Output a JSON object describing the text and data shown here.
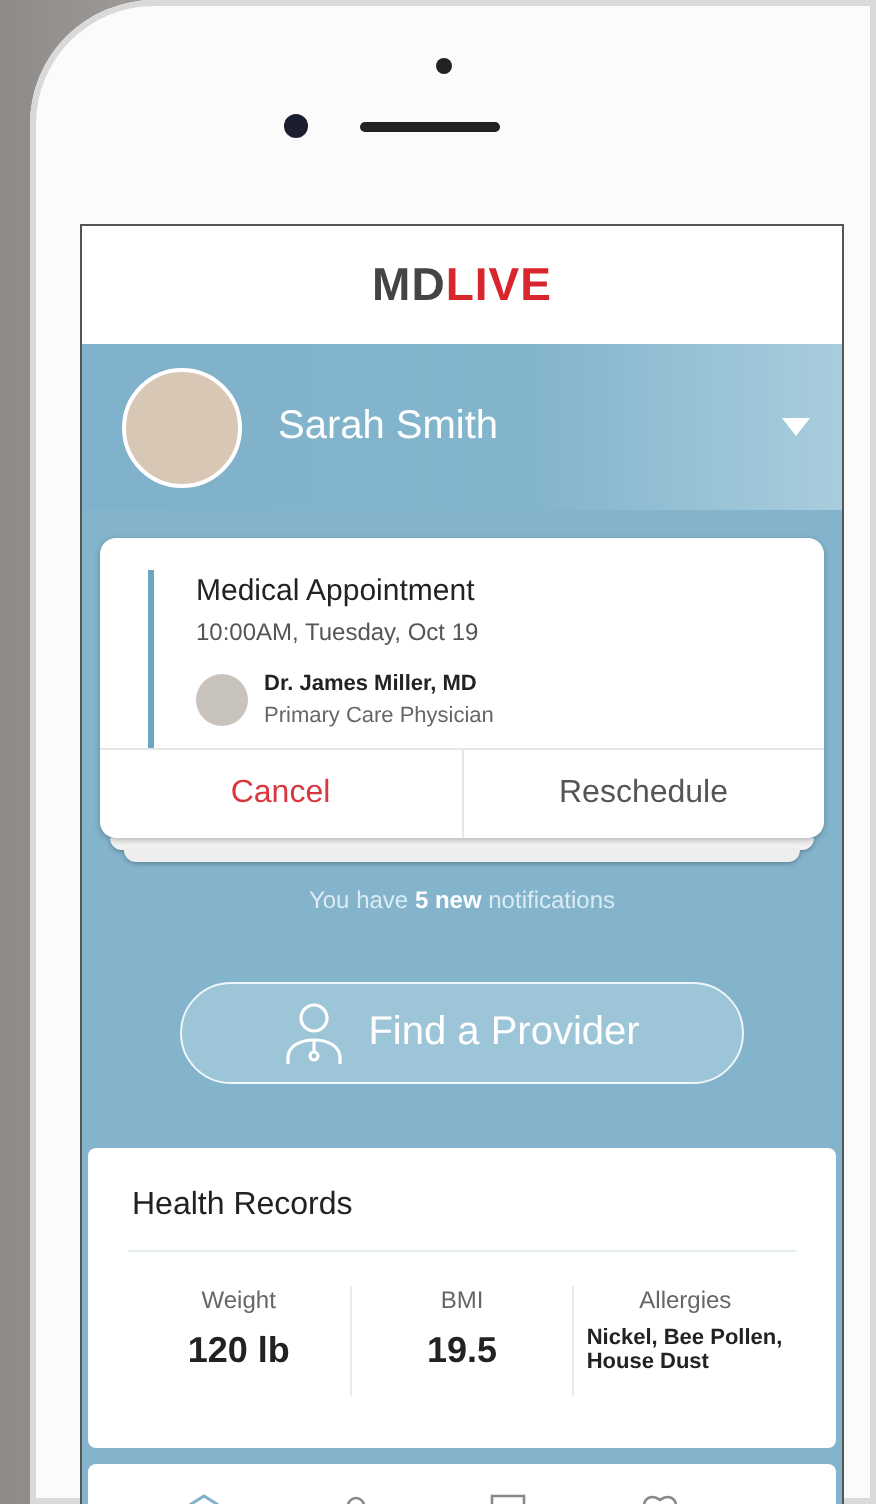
{
  "app": {
    "logo": {
      "part_1": "MD",
      "part_2": "LIVE"
    }
  },
  "profile": {
    "name": "Sarah Smith"
  },
  "appointment": {
    "title": "Medical Appointment",
    "time": "10:00AM, Tuesday, Oct 19",
    "doctor": "Dr. James Miller, MD",
    "specialty": "Primary Care Physician",
    "actions": [
      {
        "label": "Cancel",
        "kind": "destructive"
      },
      {
        "label": "Reschedule",
        "kind": "default"
      }
    ]
  },
  "notifications": "You have **5 new** notifications",
  "find_provider_button": "Find a Provider",
  "health_records": {
    "title": "Health Records",
    "stats": [
      {
        "label": "Weight",
        "value": "120 lb",
        "kind": "number"
      },
      {
        "label": "BMI",
        "value": "19.5",
        "kind": "number"
      },
      {
        "label": "Allergies",
        "value": "Nickel, Bee Pollen, House Dust",
        "kind": "text"
      }
    ]
  }
}
